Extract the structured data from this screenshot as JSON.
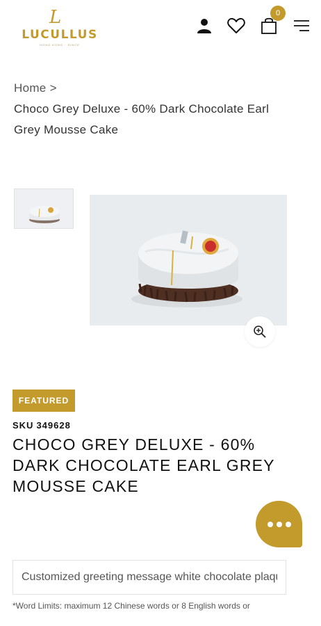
{
  "header": {
    "logo_mark": "L",
    "logo_text": "LUCULLUS",
    "logo_sub": "HONG KONG · SINCE",
    "cart_count": "0",
    "brand_color": "#c39a2c"
  },
  "breadcrumb": {
    "home": "Home >",
    "current": "Choco Grey Deluxe - 60% Dark Chocolate Earl Grey Mousse Cake"
  },
  "gallery": {
    "thumbnail_alt": "Choco Grey Deluxe cake thumbnail",
    "main_image_alt": "Choco Grey Deluxe cake",
    "zoom_icon": "zoom-in-icon"
  },
  "product": {
    "badge": "FEATURED",
    "sku_label": "SKU",
    "sku": "349628",
    "title": "CHOCO GREY DELUXE - 60% DARK CHOCOLATE EARL GREY MOUSSE CAKE"
  },
  "chat": {
    "icon": "chat-dots-icon"
  },
  "greeting": {
    "placeholder": "Customized greeting message white chocolate plaque",
    "note": "*Word Limits: maximum 12 Chinese words or 8 English words or"
  }
}
